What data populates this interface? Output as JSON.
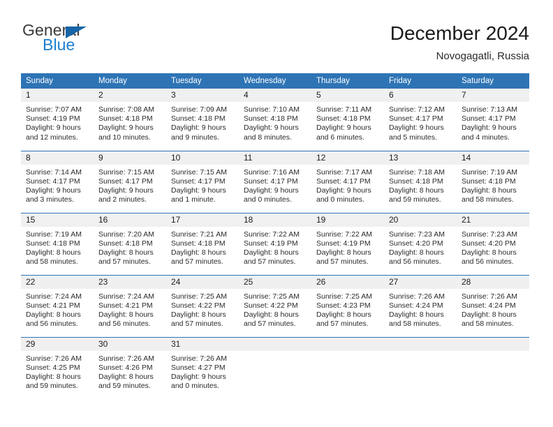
{
  "brand": {
    "name_top": "General",
    "name_bottom": "Blue",
    "triangle_color": "#1565a8",
    "blue_color": "#1b7fd0"
  },
  "header": {
    "title": "December 2024",
    "subtitle": "Novogagatli, Russia"
  },
  "theme": {
    "header_bg": "#2e74b5",
    "header_text": "#ffffff",
    "daynum_bg": "#f0f0f0",
    "divider": "#2e74b5",
    "body_text": "#2a2a2a"
  },
  "calendar": {
    "weekdays": [
      "Sunday",
      "Monday",
      "Tuesday",
      "Wednesday",
      "Thursday",
      "Friday",
      "Saturday"
    ],
    "weeks": [
      [
        {
          "day": "1",
          "sunrise": "Sunrise: 7:07 AM",
          "sunset": "Sunset: 4:19 PM",
          "daylight1": "Daylight: 9 hours",
          "daylight2": "and 12 minutes."
        },
        {
          "day": "2",
          "sunrise": "Sunrise: 7:08 AM",
          "sunset": "Sunset: 4:18 PM",
          "daylight1": "Daylight: 9 hours",
          "daylight2": "and 10 minutes."
        },
        {
          "day": "3",
          "sunrise": "Sunrise: 7:09 AM",
          "sunset": "Sunset: 4:18 PM",
          "daylight1": "Daylight: 9 hours",
          "daylight2": "and 9 minutes."
        },
        {
          "day": "4",
          "sunrise": "Sunrise: 7:10 AM",
          "sunset": "Sunset: 4:18 PM",
          "daylight1": "Daylight: 9 hours",
          "daylight2": "and 8 minutes."
        },
        {
          "day": "5",
          "sunrise": "Sunrise: 7:11 AM",
          "sunset": "Sunset: 4:18 PM",
          "daylight1": "Daylight: 9 hours",
          "daylight2": "and 6 minutes."
        },
        {
          "day": "6",
          "sunrise": "Sunrise: 7:12 AM",
          "sunset": "Sunset: 4:17 PM",
          "daylight1": "Daylight: 9 hours",
          "daylight2": "and 5 minutes."
        },
        {
          "day": "7",
          "sunrise": "Sunrise: 7:13 AM",
          "sunset": "Sunset: 4:17 PM",
          "daylight1": "Daylight: 9 hours",
          "daylight2": "and 4 minutes."
        }
      ],
      [
        {
          "day": "8",
          "sunrise": "Sunrise: 7:14 AM",
          "sunset": "Sunset: 4:17 PM",
          "daylight1": "Daylight: 9 hours",
          "daylight2": "and 3 minutes."
        },
        {
          "day": "9",
          "sunrise": "Sunrise: 7:15 AM",
          "sunset": "Sunset: 4:17 PM",
          "daylight1": "Daylight: 9 hours",
          "daylight2": "and 2 minutes."
        },
        {
          "day": "10",
          "sunrise": "Sunrise: 7:15 AM",
          "sunset": "Sunset: 4:17 PM",
          "daylight1": "Daylight: 9 hours",
          "daylight2": "and 1 minute."
        },
        {
          "day": "11",
          "sunrise": "Sunrise: 7:16 AM",
          "sunset": "Sunset: 4:17 PM",
          "daylight1": "Daylight: 9 hours",
          "daylight2": "and 0 minutes."
        },
        {
          "day": "12",
          "sunrise": "Sunrise: 7:17 AM",
          "sunset": "Sunset: 4:17 PM",
          "daylight1": "Daylight: 9 hours",
          "daylight2": "and 0 minutes."
        },
        {
          "day": "13",
          "sunrise": "Sunrise: 7:18 AM",
          "sunset": "Sunset: 4:18 PM",
          "daylight1": "Daylight: 8 hours",
          "daylight2": "and 59 minutes."
        },
        {
          "day": "14",
          "sunrise": "Sunrise: 7:19 AM",
          "sunset": "Sunset: 4:18 PM",
          "daylight1": "Daylight: 8 hours",
          "daylight2": "and 58 minutes."
        }
      ],
      [
        {
          "day": "15",
          "sunrise": "Sunrise: 7:19 AM",
          "sunset": "Sunset: 4:18 PM",
          "daylight1": "Daylight: 8 hours",
          "daylight2": "and 58 minutes."
        },
        {
          "day": "16",
          "sunrise": "Sunrise: 7:20 AM",
          "sunset": "Sunset: 4:18 PM",
          "daylight1": "Daylight: 8 hours",
          "daylight2": "and 57 minutes."
        },
        {
          "day": "17",
          "sunrise": "Sunrise: 7:21 AM",
          "sunset": "Sunset: 4:18 PM",
          "daylight1": "Daylight: 8 hours",
          "daylight2": "and 57 minutes."
        },
        {
          "day": "18",
          "sunrise": "Sunrise: 7:22 AM",
          "sunset": "Sunset: 4:19 PM",
          "daylight1": "Daylight: 8 hours",
          "daylight2": "and 57 minutes."
        },
        {
          "day": "19",
          "sunrise": "Sunrise: 7:22 AM",
          "sunset": "Sunset: 4:19 PM",
          "daylight1": "Daylight: 8 hours",
          "daylight2": "and 57 minutes."
        },
        {
          "day": "20",
          "sunrise": "Sunrise: 7:23 AM",
          "sunset": "Sunset: 4:20 PM",
          "daylight1": "Daylight: 8 hours",
          "daylight2": "and 56 minutes."
        },
        {
          "day": "21",
          "sunrise": "Sunrise: 7:23 AM",
          "sunset": "Sunset: 4:20 PM",
          "daylight1": "Daylight: 8 hours",
          "daylight2": "and 56 minutes."
        }
      ],
      [
        {
          "day": "22",
          "sunrise": "Sunrise: 7:24 AM",
          "sunset": "Sunset: 4:21 PM",
          "daylight1": "Daylight: 8 hours",
          "daylight2": "and 56 minutes."
        },
        {
          "day": "23",
          "sunrise": "Sunrise: 7:24 AM",
          "sunset": "Sunset: 4:21 PM",
          "daylight1": "Daylight: 8 hours",
          "daylight2": "and 56 minutes."
        },
        {
          "day": "24",
          "sunrise": "Sunrise: 7:25 AM",
          "sunset": "Sunset: 4:22 PM",
          "daylight1": "Daylight: 8 hours",
          "daylight2": "and 57 minutes."
        },
        {
          "day": "25",
          "sunrise": "Sunrise: 7:25 AM",
          "sunset": "Sunset: 4:22 PM",
          "daylight1": "Daylight: 8 hours",
          "daylight2": "and 57 minutes."
        },
        {
          "day": "26",
          "sunrise": "Sunrise: 7:25 AM",
          "sunset": "Sunset: 4:23 PM",
          "daylight1": "Daylight: 8 hours",
          "daylight2": "and 57 minutes."
        },
        {
          "day": "27",
          "sunrise": "Sunrise: 7:26 AM",
          "sunset": "Sunset: 4:24 PM",
          "daylight1": "Daylight: 8 hours",
          "daylight2": "and 58 minutes."
        },
        {
          "day": "28",
          "sunrise": "Sunrise: 7:26 AM",
          "sunset": "Sunset: 4:24 PM",
          "daylight1": "Daylight: 8 hours",
          "daylight2": "and 58 minutes."
        }
      ],
      [
        {
          "day": "29",
          "sunrise": "Sunrise: 7:26 AM",
          "sunset": "Sunset: 4:25 PM",
          "daylight1": "Daylight: 8 hours",
          "daylight2": "and 59 minutes."
        },
        {
          "day": "30",
          "sunrise": "Sunrise: 7:26 AM",
          "sunset": "Sunset: 4:26 PM",
          "daylight1": "Daylight: 8 hours",
          "daylight2": "and 59 minutes."
        },
        {
          "day": "31",
          "sunrise": "Sunrise: 7:26 AM",
          "sunset": "Sunset: 4:27 PM",
          "daylight1": "Daylight: 9 hours",
          "daylight2": "and 0 minutes."
        },
        {
          "day": "",
          "sunrise": "",
          "sunset": "",
          "daylight1": "",
          "daylight2": ""
        },
        {
          "day": "",
          "sunrise": "",
          "sunset": "",
          "daylight1": "",
          "daylight2": ""
        },
        {
          "day": "",
          "sunrise": "",
          "sunset": "",
          "daylight1": "",
          "daylight2": ""
        },
        {
          "day": "",
          "sunrise": "",
          "sunset": "",
          "daylight1": "",
          "daylight2": ""
        }
      ]
    ]
  }
}
